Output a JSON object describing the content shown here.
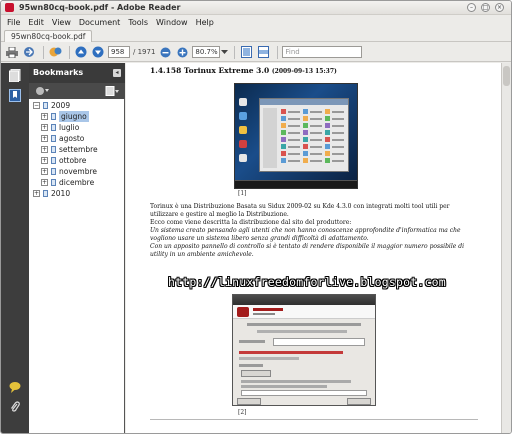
{
  "window": {
    "title": "95wn80cq-book.pdf - Adobe Reader",
    "controls": [
      "–",
      "□",
      "×"
    ]
  },
  "menu": [
    "File",
    "Edit",
    "View",
    "Document",
    "Tools",
    "Window",
    "Help"
  ],
  "tab": {
    "label": "95wn80cq-book.pdf"
  },
  "toolbar": {
    "page_current": "958",
    "page_total": "/ 1971",
    "zoom": "80.7%",
    "find_placeholder": "Find",
    "icons": [
      "print-icon",
      "share-icon",
      "collaborate-icon",
      "prev-page-icon",
      "next-page-icon",
      "zoom-out-icon",
      "zoom-in-icon",
      "zoom-dropdown-icon",
      "fit-page-icon",
      "fit-width-icon"
    ]
  },
  "navstrip": {
    "icons": [
      "pages-icon",
      "bookmarks-icon",
      "comments-icon",
      "attachments-icon"
    ]
  },
  "bookmarks": {
    "title": "Bookmarks",
    "tree": [
      {
        "label": "2009",
        "level": 0,
        "toggle": "−"
      },
      {
        "label": "giugno",
        "level": 1,
        "toggle": "+",
        "selected": true
      },
      {
        "label": "luglio",
        "level": 1,
        "toggle": "+"
      },
      {
        "label": "agosto",
        "level": 1,
        "toggle": "+"
      },
      {
        "label": "settembre",
        "level": 1,
        "toggle": "+"
      },
      {
        "label": "ottobre",
        "level": 1,
        "toggle": "+"
      },
      {
        "label": "novembre",
        "level": 1,
        "toggle": "+"
      },
      {
        "label": "dicembre",
        "level": 1,
        "toggle": "+"
      },
      {
        "label": "2010",
        "level": 0,
        "toggle": "+"
      }
    ]
  },
  "document": {
    "heading": "1.4.158    Torinux Extreme 3.0",
    "heading_time": "(2009-09-13 15:37)",
    "caption1": "[1]",
    "para1": "Torinux è una Distribuzione Basata su Sidux 2009-02 su Kde 4.3.0 con integrati molti tool utili per utilizzare e gestire al meglio la Distribuzione.",
    "para2": "Ecco come viene descritta la distribuzione dal sito del produttore:",
    "para3": "Un sistema creato pensando agli utenti che non hanno conoscenze approfondite d'informatica ma che vogliono usare un sistema libero senza grandi difficoltà di adattamento.",
    "para4": "Con un apposito pannello di controllo si è tentato di rendere disponibile il maggior numero possibile di utility in un ambiente amichevole.",
    "watermark": "http://linuxfreedomforlive.blogspot.com",
    "caption2": "[2]"
  }
}
